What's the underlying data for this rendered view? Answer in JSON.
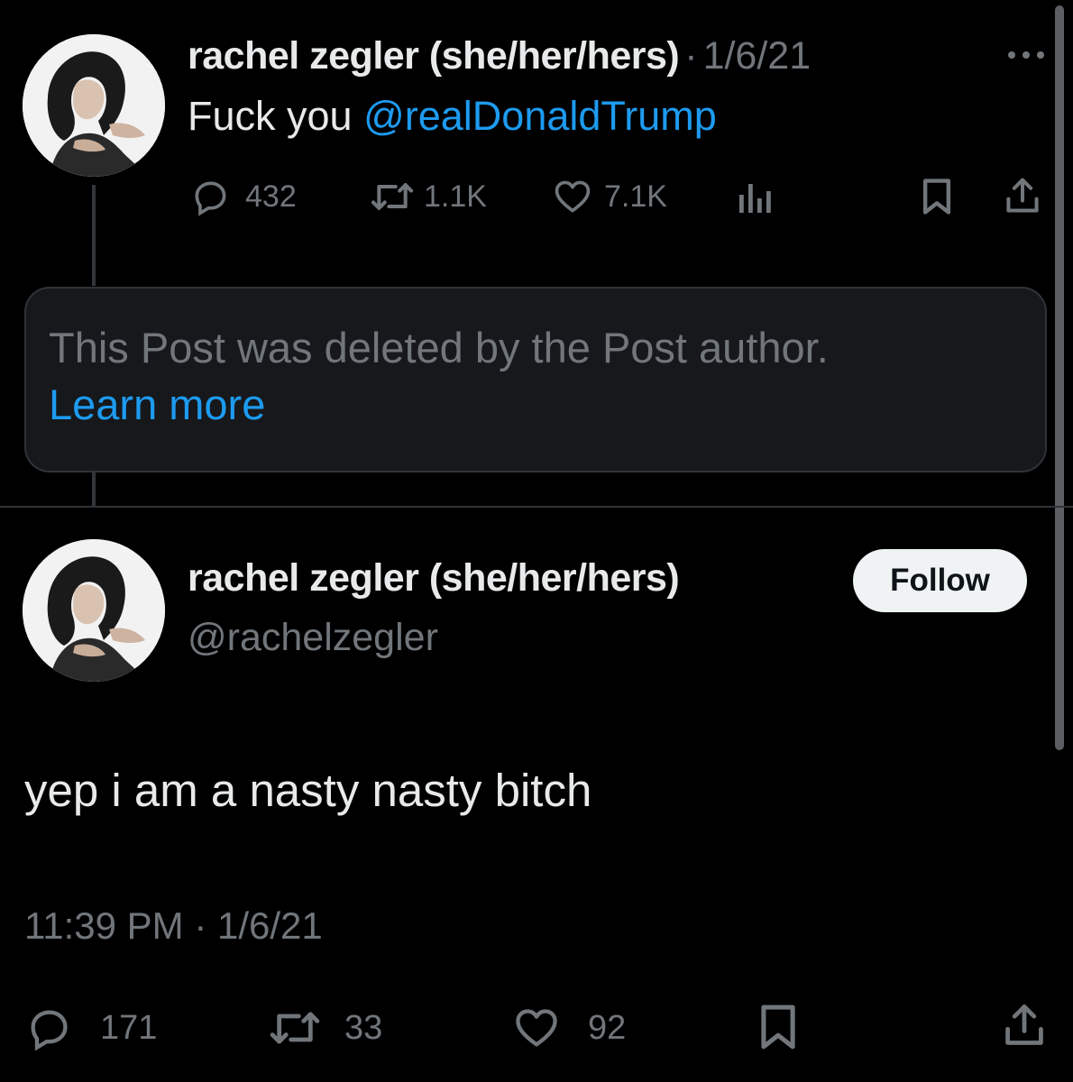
{
  "tweet1": {
    "author_name": "rachel zegler (she/her/hers)",
    "separator": "·",
    "date": "1/6/21",
    "more_icon": "more-horizontal-icon",
    "text_prefix": "Fuck you ",
    "mention": "@realDonaldTrump",
    "replies": "432",
    "retweets": "1.1K",
    "likes": "7.1K"
  },
  "deleted_notice": {
    "text": "This Post was deleted by the Post author.",
    "link": "Learn more"
  },
  "tweet2": {
    "author_name": "rachel zegler (she/her/hers)",
    "handle": "@rachelzegler",
    "follow_label": "Follow",
    "text": "yep i am a nasty nasty bitch",
    "timestamp": "11:39 PM · 1/6/21",
    "replies": "171",
    "retweets": "33",
    "likes": "92"
  },
  "icons": {
    "reply": "reply-icon",
    "retweet": "retweet-icon",
    "like": "heart-icon",
    "views": "views-icon",
    "bookmark": "bookmark-icon",
    "share": "share-icon"
  },
  "colors": {
    "background": "#000000",
    "text": "#e7e9ea",
    "muted": "#71767b",
    "accent": "#1d9bf0",
    "border": "#2f3336"
  }
}
